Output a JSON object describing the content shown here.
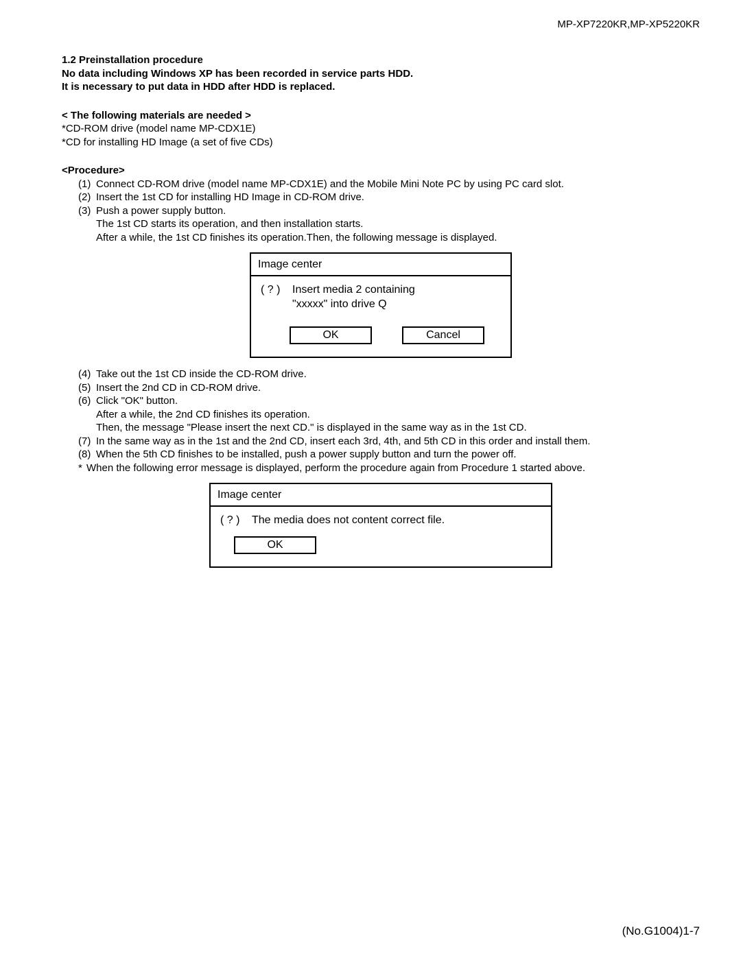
{
  "header": {
    "model": "MP-XP7220KR,MP-XP5220KR"
  },
  "section": {
    "title": "1.2  Preinstallation procedure",
    "intro_line1": "No data including Windows XP has been recorded in service parts HDD.",
    "intro_line2": "It is necessary to put data in HDD after HDD is replaced.",
    "materials_heading": "< The following materials are needed >",
    "materials_1": "*CD-ROM drive (model name MP-CDX1E)",
    "materials_2": "*CD for installing HD Image (a set of five CDs)",
    "procedure_heading": "<Procedure>",
    "steps": {
      "s1_num": "(1)",
      "s1": "Connect CD-ROM drive (model name MP-CDX1E) and the Mobile Mini Note PC by using PC card slot.",
      "s2_num": "(2)",
      "s2": "Insert the 1st CD for installing HD Image in CD-ROM drive.",
      "s3_num": "(3)",
      "s3": "Push a power supply button.",
      "s3a": "The 1st CD starts its operation, and then installation starts.",
      "s3b": "After a while, the 1st CD finishes its operation.Then, the following message is displayed.",
      "s4_num": "(4)",
      "s4": "Take out the 1st CD inside the CD-ROM drive.",
      "s5_num": "(5)",
      "s5": "Insert the 2nd CD in CD-ROM drive.",
      "s6_num": "(6)",
      "s6": "Click  \"OK\"  button.",
      "s6a": "After a while, the 2nd CD finishes its operation.",
      "s6b": "Then, the message \"Please insert the next CD.\" is displayed in the same way as in the 1st CD.",
      "s7_num": "(7)",
      "s7": "In the same way as in the 1st and the 2nd CD, insert each 3rd, 4th, and 5th CD in this order and install them.",
      "s8_num": "(8)",
      "s8": "When the 5th CD finishes to be installed, push a power supply button and turn the power off.",
      "star": "*",
      "star_line": "When the following error message is displayed, perform the procedure again from Procedure 1 started above."
    }
  },
  "dialog1": {
    "title": "Image center",
    "qmark": "( ? )",
    "msg_line1": "Insert media 2 containing",
    "msg_line2": "\"xxxxx\"  into drive Q",
    "ok": "OK",
    "cancel": "Cancel"
  },
  "dialog2": {
    "title": "Image center",
    "qmark": "( ? )",
    "msg": "The media does not content correct file.",
    "ok": "OK"
  },
  "footer": {
    "pagenum": "(No.G1004)1-7"
  }
}
